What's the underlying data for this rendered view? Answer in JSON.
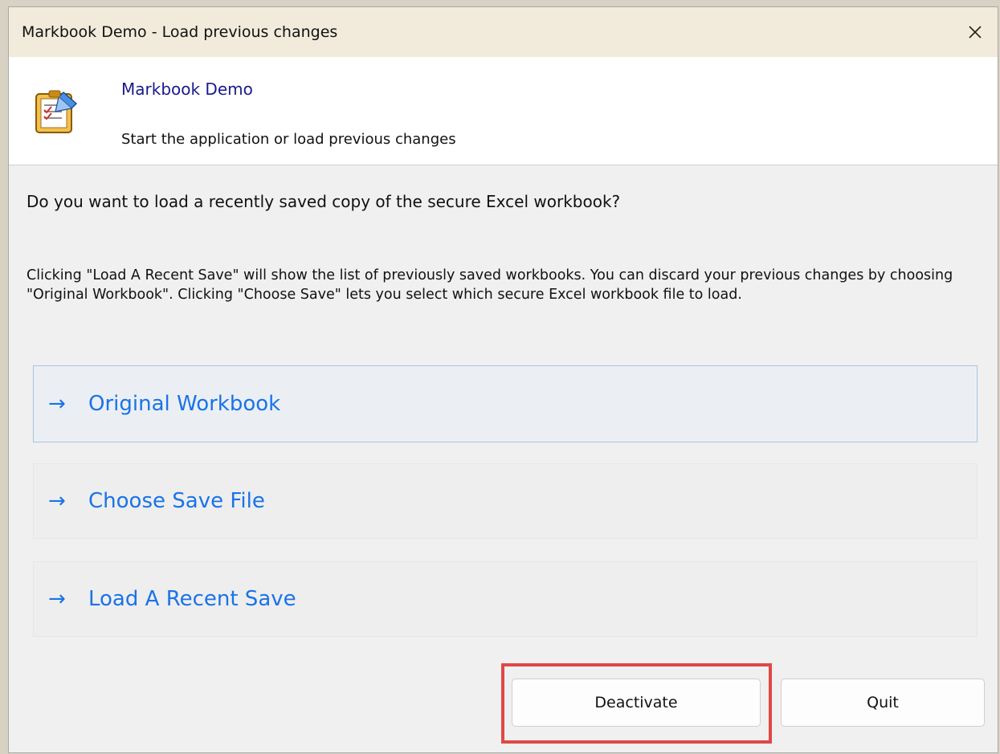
{
  "window": {
    "title": "Markbook Demo - Load previous changes",
    "close_icon": "close-icon"
  },
  "header": {
    "app_icon": "notebook-app-icon",
    "title": "Markbook Demo",
    "subtitle": "Start the application or load previous changes"
  },
  "body": {
    "question": "Do you want to load a recently saved copy of the secure Excel workbook?",
    "description": "Clicking \"Load A Recent Save\" will show the list of previously saved workbooks. You can discard your previous changes by choosing \"Original Workbook\". Clicking \"Choose Save\" lets you select which secure Excel workbook file to load."
  },
  "options": [
    {
      "arrow": "→",
      "label": "Original Workbook",
      "icon": "arrow-right-icon"
    },
    {
      "arrow": "→",
      "label": "Choose Save File",
      "icon": "arrow-right-icon"
    },
    {
      "arrow": "→",
      "label": "Load A Recent Save",
      "icon": "arrow-right-icon"
    }
  ],
  "buttons": {
    "deactivate": "Deactivate",
    "quit": "Quit"
  },
  "colors": {
    "accent": "#1a73e8",
    "title_bar": "#f2ebdb",
    "header_title": "#1a1a8c",
    "highlight": "#e04848"
  }
}
